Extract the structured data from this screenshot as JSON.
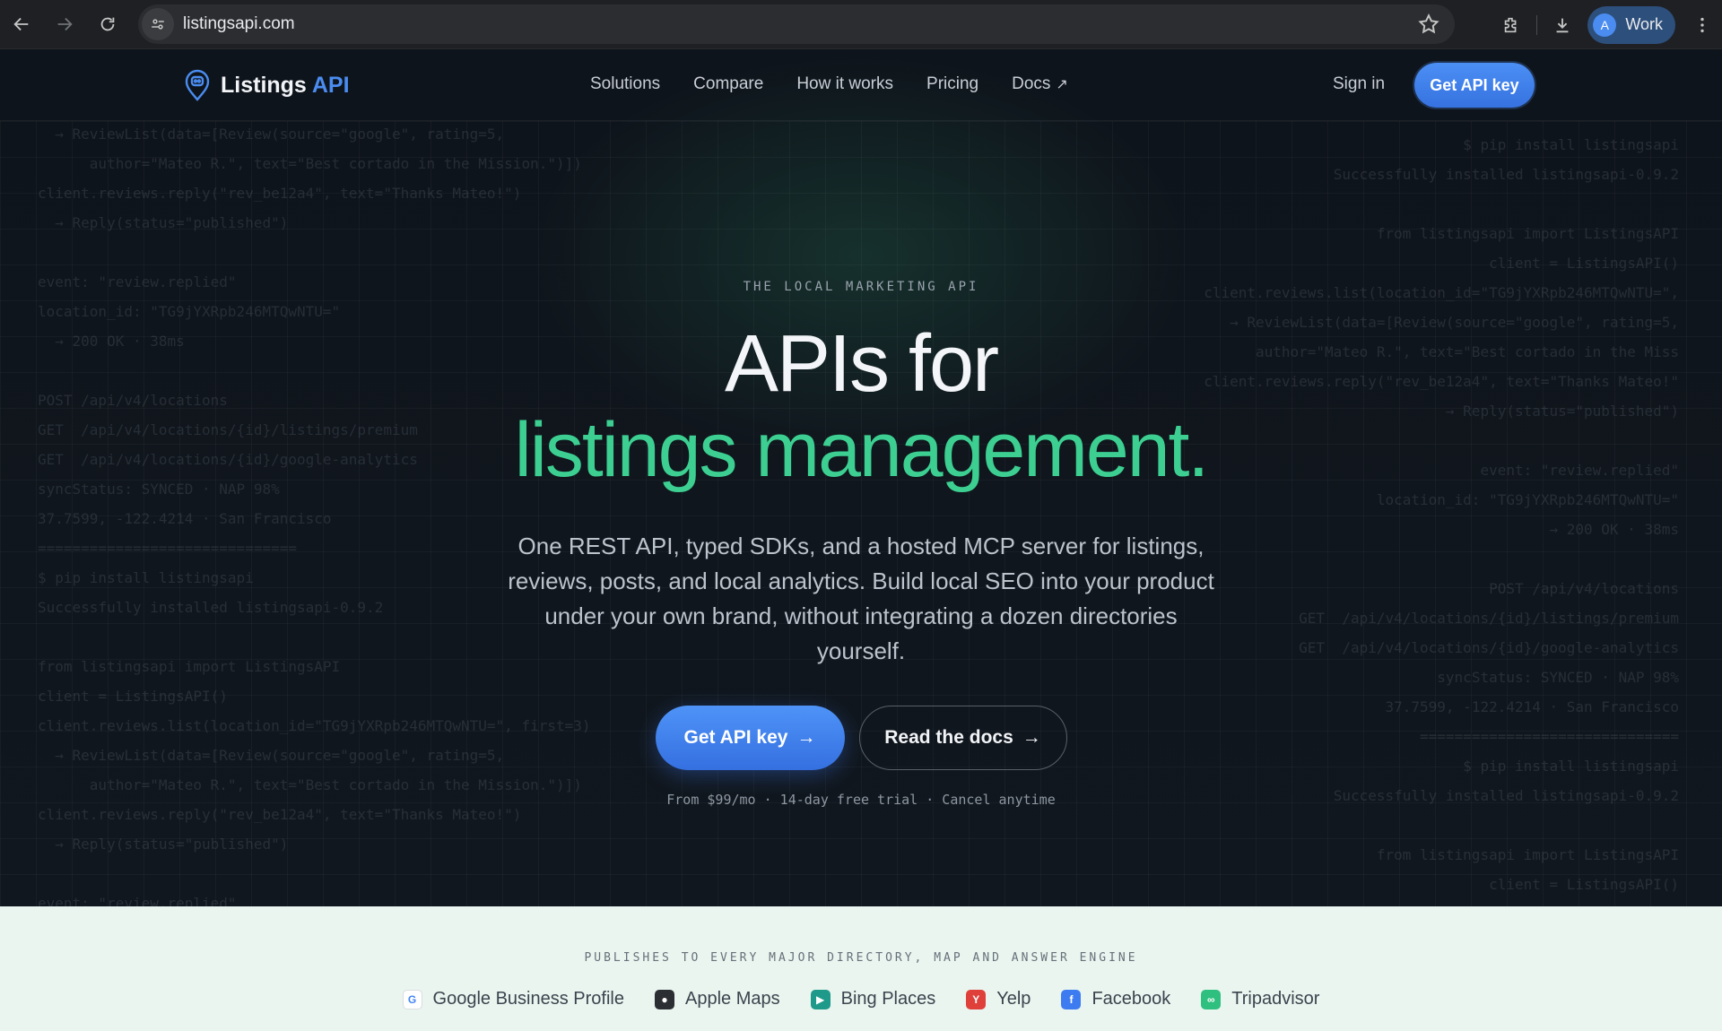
{
  "browser": {
    "url": "listingsapi.com",
    "profile_initial": "A",
    "profile_name": "Work"
  },
  "nav": {
    "logo_primary": "Listings",
    "logo_accent": "API",
    "menu": [
      {
        "label": "Solutions"
      },
      {
        "label": "Compare"
      },
      {
        "label": "How it works"
      },
      {
        "label": "Pricing"
      },
      {
        "label": "Docs",
        "external_glyph": "↗"
      }
    ],
    "sign_in": "Sign in",
    "cta": "Get API key"
  },
  "hero": {
    "eyebrow": "THE LOCAL MARKETING API",
    "headline_line1": "APIs for",
    "headline_line2": "listings management.",
    "subhead": "One REST API, typed SDKs, and a hosted MCP server for listings, reviews, posts, and local analytics. Build local SEO into your product under your own brand, without integrating a dozen directories yourself.",
    "primary_cta": "Get API key",
    "secondary_cta": "Read the docs",
    "arrow": "→",
    "fineprint": "From $99/mo · 14-day free trial · Cancel anytime"
  },
  "background_code": {
    "left": "  → ReviewList(data=[Review(source=\"google\", rating=5,\n      author=\"Mateo R.\", text=\"Best cortado in the Mission.\")])\nclient.reviews.reply(\"rev_be12a4\", text=\"Thanks Mateo!\")\n  → Reply(status=\"published\")\n\nevent: \"review.replied\"\nlocation_id: \"TG9jYXRpb246MTQwNTU=\"\n  → 200 OK · 38ms\n\nPOST /api/v4/locations\nGET  /api/v4/locations/{id}/listings/premium\nGET  /api/v4/locations/{id}/google-analytics\nsyncStatus: SYNCED · NAP 98%\n37.7599, -122.4214 · San Francisco\n==============================\n$ pip install listingsapi\nSuccessfully installed listingsapi-0.9.2\n\nfrom listingsapi import ListingsAPI\nclient = ListingsAPI()\nclient.reviews.list(location_id=\"TG9jYXRpb246MTQwNTU=\", first=3)\n  → ReviewList(data=[Review(source=\"google\", rating=5,\n      author=\"Mateo R.\", text=\"Best cortado in the Mission.\")])\nclient.reviews.reply(\"rev_be12a4\", text=\"Thanks Mateo!\")\n  → Reply(status=\"published\")\n\nevent: \"review.replied\"",
    "right": "$ pip install listingsapi\nSuccessfully installed listingsapi-0.9.2\n\nfrom listingsapi import ListingsAPI\nclient = ListingsAPI()\nclient.reviews.list(location_id=\"TG9jYXRpb246MTQwNTU=\",\n  → ReviewList(data=[Review(source=\"google\", rating=5,\n      author=\"Mateo R.\", text=\"Best cortado in the Miss\nclient.reviews.reply(\"rev_be12a4\", text=\"Thanks Mateo!\"\n  → Reply(status=\"published\")\n\nevent: \"review.replied\"\nlocation_id: \"TG9jYXRpb246MTQwNTU=\"\n  → 200 OK · 38ms\n\nPOST /api/v4/locations\nGET  /api/v4/locations/{id}/listings/premium\nGET  /api/v4/locations/{id}/google-analytics\nsyncStatus: SYNCED · NAP 98%\n37.7599, -122.4214 · San Francisco\n==============================\n$ pip install listingsapi\nSuccessfully installed listingsapi-0.9.2\n\nfrom listingsapi import ListingsAPI\nclient = ListingsAPI()"
  },
  "directories": {
    "title": "PUBLISHES TO EVERY MAJOR DIRECTORY, MAP AND ANSWER ENGINE",
    "items": [
      {
        "label": "Google Business Profile",
        "badge": "G",
        "color": "#ffffff",
        "glyph_color": "#4285f4"
      },
      {
        "label": "Apple Maps",
        "badge": "",
        "color": "#2b2f33",
        "glyph_color": "#ffffff"
      },
      {
        "label": "Bing Places",
        "badge": "▶",
        "color": "#1f9a8a",
        "glyph_color": "#ffffff"
      },
      {
        "label": "Yelp",
        "badge": "Y",
        "color": "#e0403a",
        "glyph_color": "#ffffff"
      },
      {
        "label": "Facebook",
        "badge": "f",
        "color": "#3d7cf0",
        "glyph_color": "#ffffff"
      },
      {
        "label": "Tripadvisor",
        "badge": "∞",
        "color": "#2fbf7f",
        "glyph_color": "#ffffff"
      }
    ]
  },
  "colors": {
    "accent_blue": "#4a8cf0",
    "accent_green": "#3ccf91",
    "hero_bg": "#0e141b",
    "band_bg": "#eaf5ef"
  }
}
